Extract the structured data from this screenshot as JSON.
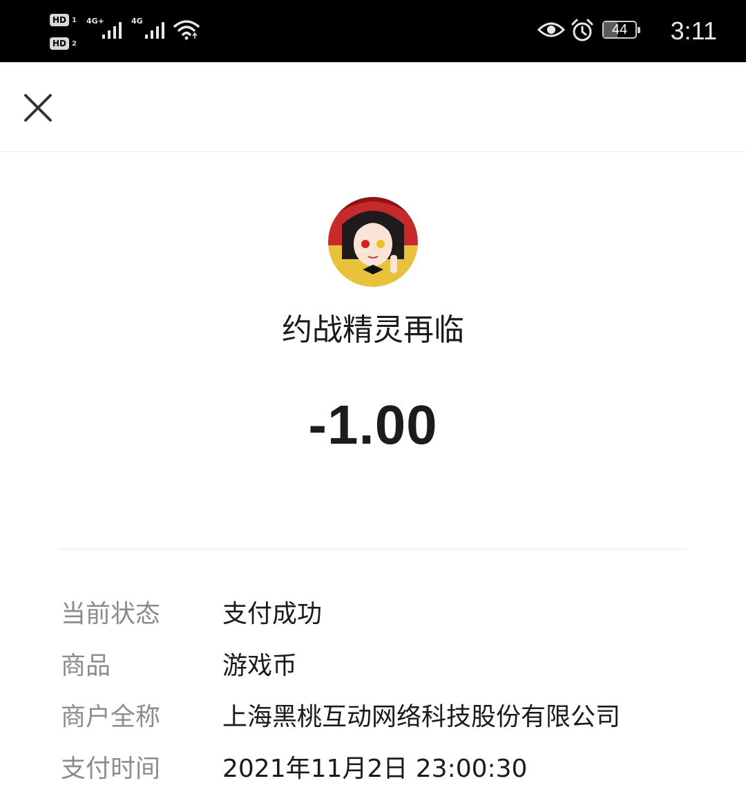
{
  "status_bar": {
    "sim1_badge": "HD",
    "sim1_number": "1",
    "sim2_badge": "HD",
    "sim2_number": "2",
    "network1_type": "4G+",
    "network2_type": "4G",
    "battery_percent": "44",
    "battery_level": 0.44,
    "time": "3:11",
    "icons": [
      "hd-volte-icon",
      "signal-icon",
      "wifi-icon",
      "eye-comfort-icon",
      "alarm-icon",
      "battery-icon"
    ]
  },
  "header": {
    "close_icon": "close-icon"
  },
  "merchant": {
    "avatar_icon": "merchant-avatar",
    "name": "约战精灵再临"
  },
  "amount": "-1.00",
  "details": [
    {
      "label": "当前状态",
      "value": "支付成功"
    },
    {
      "label": "商品",
      "value": "游戏币"
    },
    {
      "label": "商户全称",
      "value": "上海黑桃互动网络科技股份有限公司"
    },
    {
      "label": "支付时间",
      "value": "2021年11月2日 23:00:30"
    }
  ],
  "colors": {
    "status_bar_bg": "#000000",
    "page_bg": "#ffffff",
    "label_text": "#8c8c8c",
    "value_text": "#1a1a1a",
    "divider": "#e6e6e6"
  }
}
